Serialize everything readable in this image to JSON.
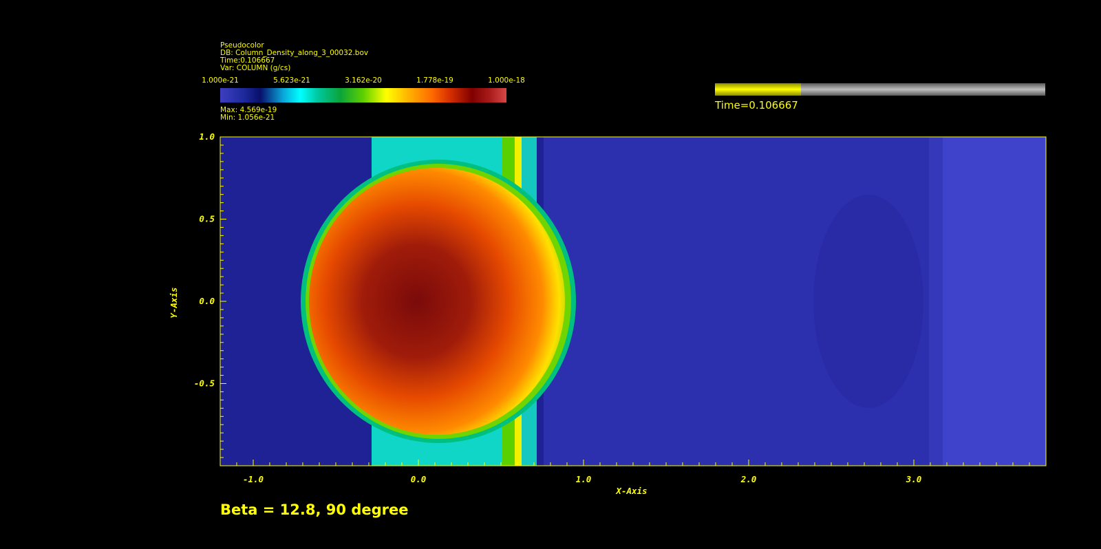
{
  "legend": {
    "plot_type": "Pseudocolor",
    "db": "DB: Column_Density_along_3_00032.bov",
    "time": "Time:0.106667",
    "var": "Var: COLUMN (g/cs)",
    "ticks": [
      "1.000e-21",
      "5.623e-21",
      "3.162e-20",
      "1.778e-19",
      "1.000e-18"
    ],
    "max": "Max:  4.569e-19",
    "min": "Min:  1.056e-21"
  },
  "time_slider": {
    "label": "Time=0.106667",
    "fraction": 0.26
  },
  "caption": "Beta = 12.8, 90 degree",
  "chart_data": {
    "type": "heatmap",
    "xlabel": "X-Axis",
    "ylabel": "Y-Axis",
    "xlim": [
      -1.2,
      3.8
    ],
    "ylim": [
      -1.0,
      1.0
    ],
    "x_ticks": [
      "-1.0",
      "0.0",
      "1.0",
      "2.0",
      "3.0"
    ],
    "x_tick_values": [
      -1.0,
      0.0,
      1.0,
      2.0,
      3.0
    ],
    "y_ticks": [
      "1.0",
      "0.5",
      "0.0",
      "-0.5"
    ],
    "y_tick_values": [
      1.0,
      0.5,
      0.0,
      -0.5
    ],
    "colorscale": "log",
    "colorbar_range": [
      1e-21,
      1e-18
    ],
    "features": {
      "cloud_center": [
        0.0,
        0.0
      ],
      "cloud_left_edge_x": -0.7,
      "shock_x": 0.65,
      "right_edge_x": 0.95,
      "far_band_x": 3.3
    }
  }
}
